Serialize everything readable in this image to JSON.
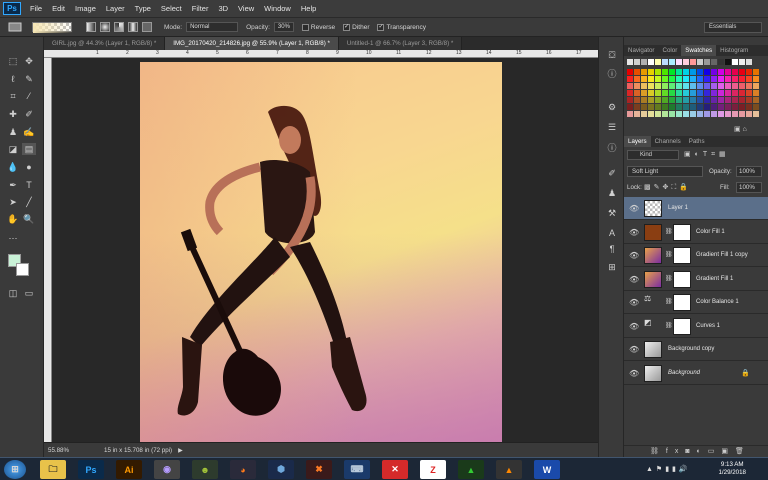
{
  "app": {
    "logo": "Ps",
    "menu": [
      "File",
      "Edit",
      "Image",
      "Layer",
      "Type",
      "Select",
      "Filter",
      "3D",
      "View",
      "Window",
      "Help"
    ]
  },
  "options": {
    "mode_label": "Mode:",
    "mode_value": "Normal",
    "opacity_label": "Opacity:",
    "opacity_value": "30%",
    "reverse_label": "Reverse",
    "dither_label": "Dither",
    "transparency_label": "Transparency",
    "workspace": "Essentials"
  },
  "tabs": [
    {
      "label": "GIRL.jpg @ 44.3% (Layer 1, RGB/8) *",
      "active": false
    },
    {
      "label": "IMG_20170420_214826.jpg @ 55.9% (Layer 1, RGB/8) *",
      "active": true
    },
    {
      "label": "Untitled-1 @ 66.7% (Layer 3, RGB/8) *",
      "active": false
    }
  ],
  "rulers": {
    "top": [
      "1",
      "2",
      "3",
      "4",
      "5",
      "6",
      "7",
      "8",
      "9",
      "10",
      "11",
      "12",
      "13",
      "14",
      "15",
      "16",
      "17",
      "18",
      "19"
    ]
  },
  "status": {
    "zoom": "55.88%",
    "doc_size": "15 in x 15.708 in (72 ppi)"
  },
  "colors": {
    "foreground": "#c9f2d7",
    "background": "#ffffff"
  },
  "panels": {
    "top_tabs": [
      "Navigator",
      "Color",
      "Swatches",
      "Histogram"
    ],
    "top_active": "Swatches",
    "layer_tabs": [
      "Layers",
      "Channels",
      "Paths"
    ],
    "layer_active": "Layers",
    "filter_kind": "Kind",
    "blend_mode": "Soft Light",
    "opacity_label": "Opacity:",
    "opacity_value": "100%",
    "lock_label": "Lock:",
    "fill_label": "Fill:",
    "fill_value": "100%"
  },
  "layers": [
    {
      "name": "Layer 1",
      "selected": true,
      "thumb": "checker",
      "mask": false
    },
    {
      "name": "Color Fill 1",
      "selected": false,
      "thumb": "#8a3e12",
      "mask": true
    },
    {
      "name": "Gradient Fill 1 copy",
      "selected": false,
      "thumb": "gradient",
      "mask": true
    },
    {
      "name": "Gradient Fill 1",
      "selected": false,
      "thumb": "gradient",
      "mask": true
    },
    {
      "name": "Color Balance 1",
      "selected": false,
      "thumb": "balance",
      "mask": true
    },
    {
      "name": "Curves 1",
      "selected": false,
      "thumb": "curves",
      "mask": true
    },
    {
      "name": "Background copy",
      "selected": false,
      "thumb": "photo",
      "mask": false
    },
    {
      "name": "Background",
      "selected": false,
      "thumb": "photo",
      "mask": false,
      "locked": true
    }
  ],
  "taskbar": {
    "apps": [
      "Explorer",
      "Ps",
      "Ai",
      "Player",
      "Android",
      "Firefox",
      "VirtualBox",
      "XAMPP",
      "Network",
      "Close",
      "Z",
      "Sync",
      "VLC",
      "W"
    ],
    "time": "9:13 AM",
    "date": "1/29/2018"
  },
  "icons": {
    "eye": "eye-icon",
    "lock": "lock-icon"
  }
}
